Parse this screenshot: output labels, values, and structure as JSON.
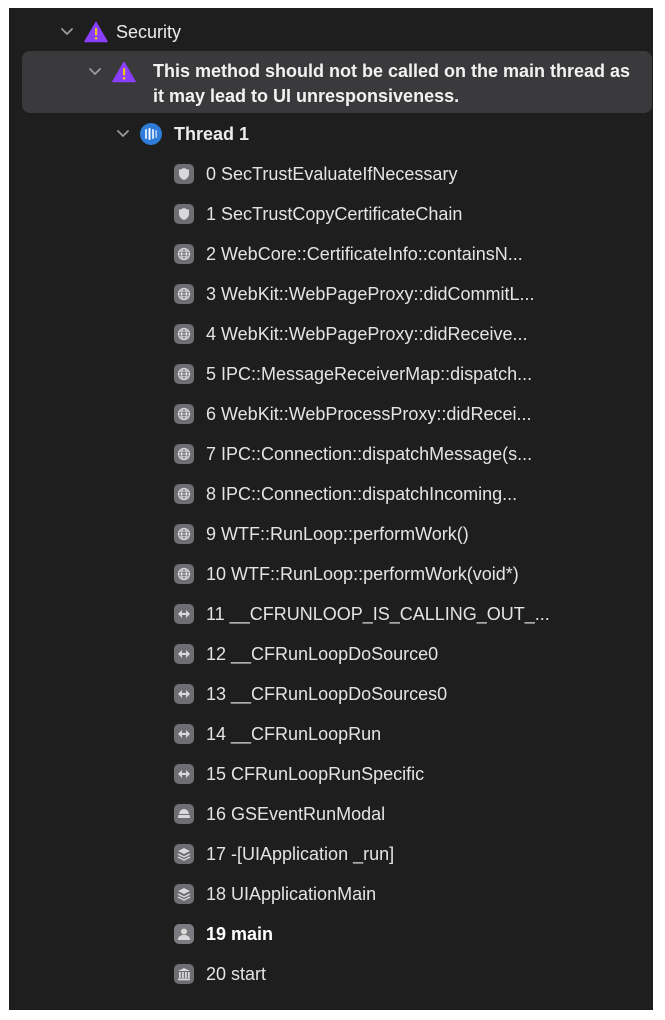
{
  "category": {
    "label": "Security"
  },
  "issue": {
    "message": "This method should not be called on the main thread as it may lead to UI unresponsiveness."
  },
  "thread": {
    "label": "Thread 1"
  },
  "frames": [
    {
      "label": "0 SecTrustEvaluateIfNecessary",
      "icon": "shield-icon"
    },
    {
      "label": "1 SecTrustCopyCertificateChain",
      "icon": "shield-icon"
    },
    {
      "label": "2 WebCore::CertificateInfo::containsN...",
      "icon": "globe-icon"
    },
    {
      "label": "3 WebKit::WebPageProxy::didCommitL...",
      "icon": "globe-icon"
    },
    {
      "label": "4 WebKit::WebPageProxy::didReceive...",
      "icon": "globe-icon"
    },
    {
      "label": "5 IPC::MessageReceiverMap::dispatch...",
      "icon": "globe-icon"
    },
    {
      "label": "6 WebKit::WebProcessProxy::didRecei...",
      "icon": "globe-icon"
    },
    {
      "label": "7 IPC::Connection::dispatchMessage(s...",
      "icon": "globe-icon"
    },
    {
      "label": "8 IPC::Connection::dispatchIncoming...",
      "icon": "globe-icon"
    },
    {
      "label": "9 WTF::RunLoop::performWork()",
      "icon": "globe-icon"
    },
    {
      "label": "10 WTF::RunLoop::performWork(void*)",
      "icon": "globe-icon"
    },
    {
      "label": "11 __CFRUNLOOP_IS_CALLING_OUT_...",
      "icon": "runloop-icon"
    },
    {
      "label": "12 __CFRunLoopDoSource0",
      "icon": "runloop-icon"
    },
    {
      "label": "13 __CFRunLoopDoSources0",
      "icon": "runloop-icon"
    },
    {
      "label": "14 __CFRunLoopRun",
      "icon": "runloop-icon"
    },
    {
      "label": "15 CFRunLoopRunSpecific",
      "icon": "runloop-icon"
    },
    {
      "label": "16 GSEventRunModal",
      "icon": "graphics-services-icon"
    },
    {
      "label": "17 -[UIApplication _run]",
      "icon": "stack-icon"
    },
    {
      "label": "18 UIApplicationMain",
      "icon": "stack-icon"
    },
    {
      "label": "19 main",
      "icon": "user-icon",
      "bold": true
    },
    {
      "label": "20 start",
      "icon": "building-icon"
    }
  ],
  "colors": {
    "panel_bg": "#1e1e1e",
    "issue_highlight": "#3a3a3c",
    "warning_purple": "#8a3ffc",
    "thread_blue": "#2f7bd8",
    "frame_icon_gray": "#6e6e73"
  }
}
